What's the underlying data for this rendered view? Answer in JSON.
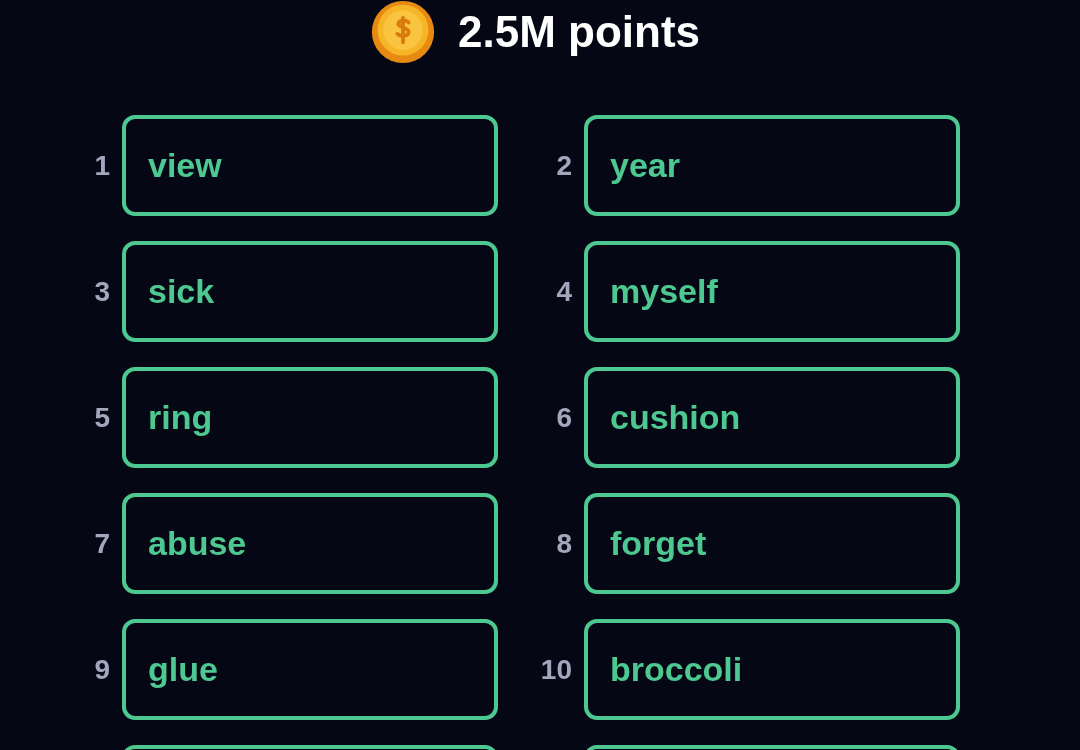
{
  "header": {
    "points": "2.5M points"
  },
  "words": [
    {
      "number": "1",
      "word": "view"
    },
    {
      "number": "2",
      "word": "year"
    },
    {
      "number": "3",
      "word": "sick"
    },
    {
      "number": "4",
      "word": "myself"
    },
    {
      "number": "5",
      "word": "ring"
    },
    {
      "number": "6",
      "word": "cushion"
    },
    {
      "number": "7",
      "word": "abuse"
    },
    {
      "number": "8",
      "word": "forget"
    },
    {
      "number": "9",
      "word": "glue"
    },
    {
      "number": "10",
      "word": "broccoli"
    }
  ],
  "partial_row_below": true
}
